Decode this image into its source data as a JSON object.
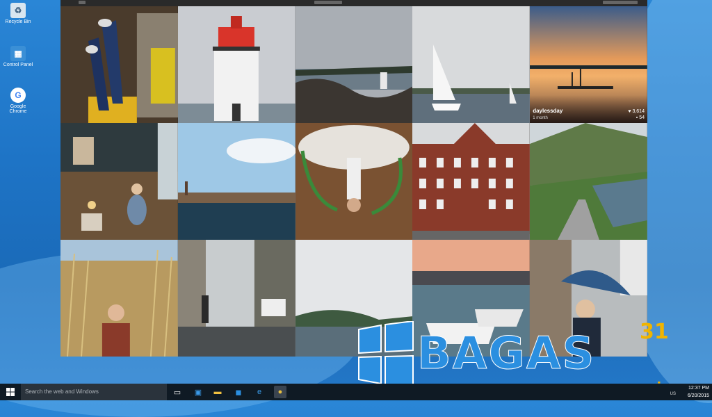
{
  "desktop": {
    "icons": [
      {
        "label": "Recycle Bin",
        "icon": "recycle-bin-icon"
      },
      {
        "label": "Control Panel",
        "icon": "control-panel-icon"
      },
      {
        "label": "Google Chrome",
        "icon": "chrome-icon"
      }
    ]
  },
  "gallery": {
    "featured": {
      "username": "daylessday",
      "time": "1 month",
      "likes": "3,614",
      "comments": "54"
    }
  },
  "watermark": {
    "brand": "BAGAS",
    "number": "31",
    "domain": ".com.in"
  },
  "taskbar": {
    "search_placeholder": "Search the web and Windows",
    "time": "12:37 PM",
    "date": "6/20/2015",
    "lang": "US",
    "pinned": [
      "task-view-icon",
      "store-icon",
      "file-explorer-icon",
      "outlook-icon",
      "edge-icon",
      "chrome-icon"
    ]
  },
  "colors": {
    "accent": "#2b8fe0",
    "taskbar": "#0f1a24",
    "watermark_gold": "#f0b400"
  }
}
